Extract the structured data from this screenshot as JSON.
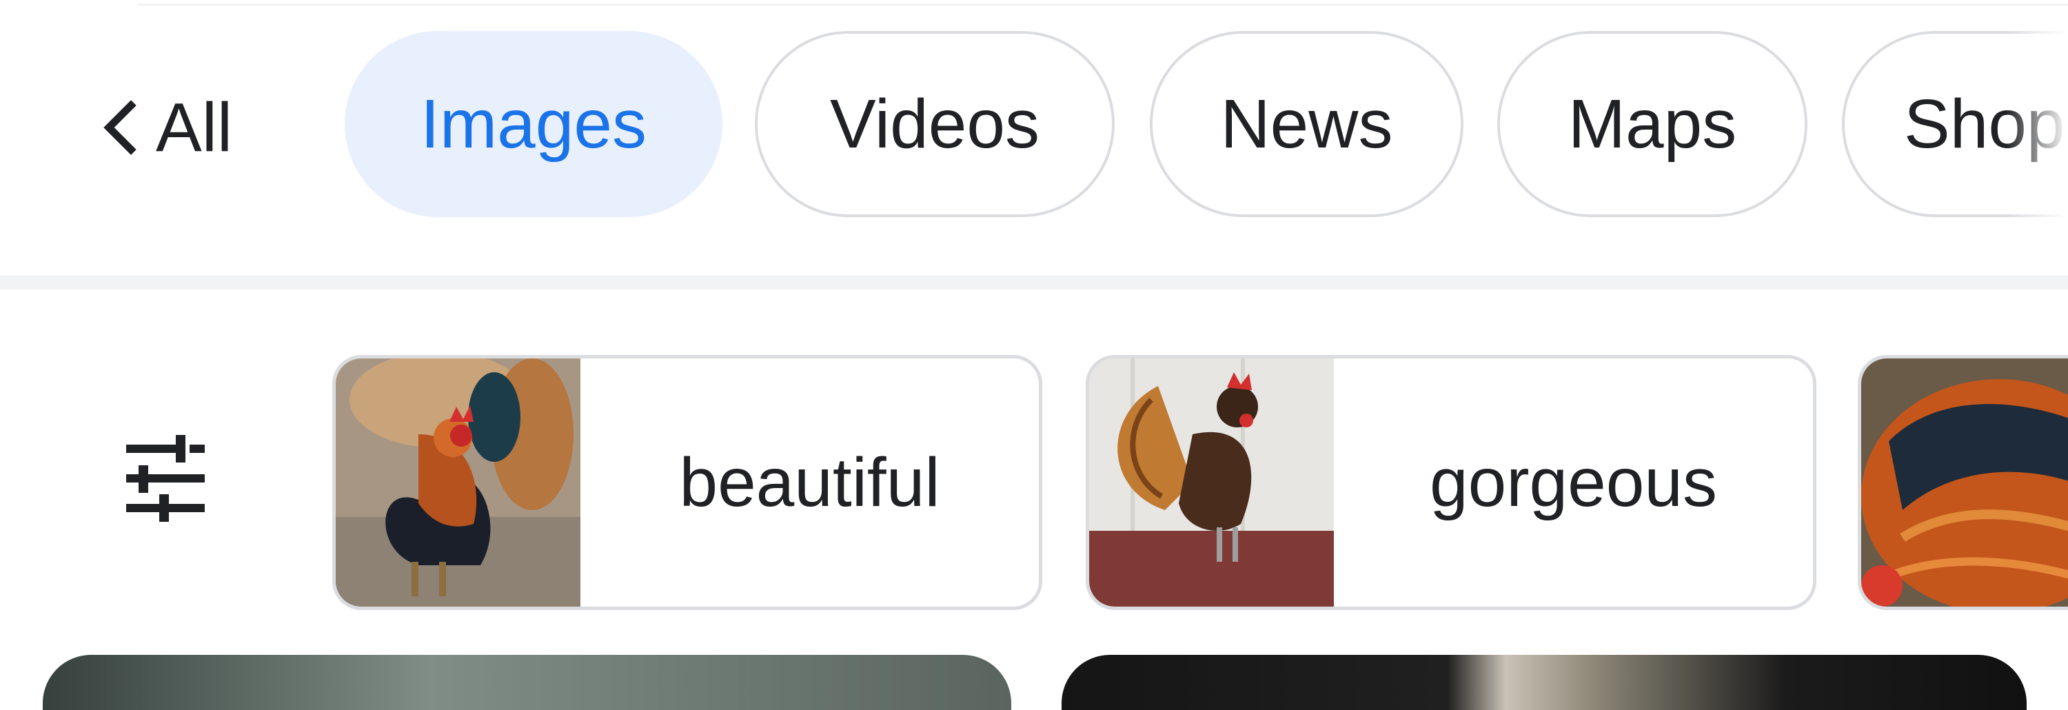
{
  "nav": {
    "back_label": "All",
    "tabs": [
      {
        "label": "Images",
        "active": true
      },
      {
        "label": "Videos",
        "active": false
      },
      {
        "label": "News",
        "active": false
      },
      {
        "label": "Maps",
        "active": false
      },
      {
        "label": "Shop",
        "active": false
      }
    ]
  },
  "refinements": {
    "tools_icon": "tune-sliders-icon",
    "chips": [
      {
        "label": "beautiful",
        "thumb": "rooster photo"
      },
      {
        "label": "gorgeous",
        "thumb": "bantam rooster photo"
      },
      {
        "label": "",
        "thumb": "orange-black rooster photo"
      }
    ]
  },
  "colors": {
    "active_tab_bg": "#e8f0fe",
    "active_tab_text": "#1a73e8",
    "chip_border": "#dadce0",
    "text": "#202124"
  }
}
